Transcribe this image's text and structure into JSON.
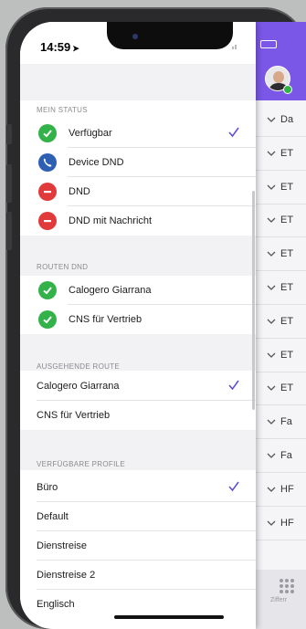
{
  "status_bar": {
    "time": "14:59"
  },
  "sections": {
    "mein_status": {
      "label": "MEIN STATUS",
      "items": [
        {
          "label": "Verfügbar",
          "icon": "check-circle-icon",
          "color": "#34b24a",
          "selected": true
        },
        {
          "label": "Device DND",
          "icon": "phone-icon",
          "color": "#2d5fb3",
          "selected": false
        },
        {
          "label": "DND",
          "icon": "minus-circle-icon",
          "color": "#e03a3a",
          "selected": false
        },
        {
          "label": "DND mit Nachricht",
          "icon": "minus-circle-icon",
          "color": "#e03a3a",
          "selected": false
        }
      ]
    },
    "routen_dnd": {
      "label": "ROUTEN DND",
      "items": [
        {
          "label": "Calogero Giarrana",
          "icon": "check-circle-icon",
          "color": "#34b24a"
        },
        {
          "label": "CNS für Vertrieb",
          "icon": "check-circle-icon",
          "color": "#34b24a"
        }
      ]
    },
    "ausgehende_route": {
      "label": "AUSGEHENDE ROUTE",
      "items": [
        {
          "label": "Calogero Giarrana",
          "selected": true
        },
        {
          "label": "CNS für Vertrieb",
          "selected": false
        }
      ]
    },
    "verfuegbare_profile": {
      "label": "VERFÜGBARE PROFILE",
      "items": [
        {
          "label": "Büro",
          "selected": true
        },
        {
          "label": "Default",
          "selected": false
        },
        {
          "label": "Dienstreise",
          "selected": false
        },
        {
          "label": "Dienstreise 2",
          "selected": false
        },
        {
          "label": "Englisch",
          "selected": false
        }
      ]
    }
  },
  "background_list": {
    "rows": [
      "Da",
      "ET",
      "ET",
      "ET",
      "ET",
      "ET",
      "ET",
      "ET",
      "ET",
      "Fa",
      "Fa",
      "HF",
      "HF"
    ],
    "bottom_label": "Zifferr"
  },
  "colors": {
    "accent": "#7a57e6",
    "check": "#5b4ed6"
  }
}
